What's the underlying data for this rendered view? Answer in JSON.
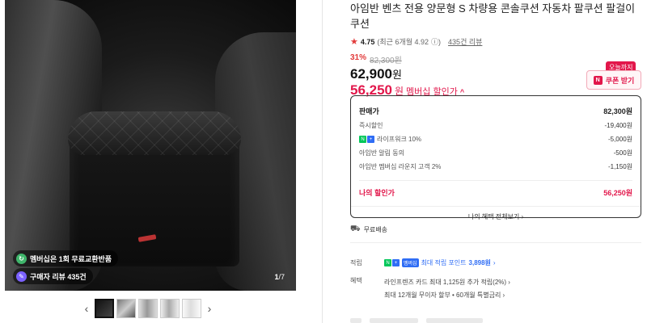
{
  "gallery": {
    "badge_membership": "멤버십은 1회 무료교환반품",
    "badge_reviews": "구매자 리뷰 435건",
    "counter_current": "1",
    "counter_total": "/7"
  },
  "product": {
    "title": "아임반 벤츠 전용 양문형 S 차량용 콘솔쿠션 자동차 팔쿠션 팔걸이쿠션",
    "rating": "4.75",
    "rating_detail": "(최근 6개월 4.92",
    "rating_info": "ⓘ)",
    "review_count": "435건 리뷰",
    "discount_pct": "31%",
    "original_price": "82,300원",
    "sale_price": "62,900",
    "sale_unit": "원",
    "member_price": "56,250",
    "member_unit": "원",
    "member_label": "멤버십 할인가",
    "coupon_label": "쿠폰 받기",
    "today_label": "오늘까지"
  },
  "breakdown": {
    "rows": [
      {
        "label": "판매가",
        "value": "82,300원"
      },
      {
        "label": "즉시할인",
        "value": "-19,400원"
      },
      {
        "label": "라이프워크 10%",
        "value": "-5,000원"
      },
      {
        "label": "아임반 알림 동의",
        "value": "-500원"
      },
      {
        "label": "아임반 멤버십 라운지 고객 2%",
        "value": "-1,150원"
      }
    ],
    "mine_label": "나의 할인가",
    "mine_value": "56,250원",
    "view_all": "나의 혜택 전체보기 ›"
  },
  "shipping": {
    "label": "무료배송"
  },
  "points": {
    "key": "적립",
    "text": "최대 적립 포인트",
    "amount": "3,898원",
    "suffix": "›"
  },
  "benefits": {
    "key": "혜택",
    "line1": "라인프렌즈 카드 최대 1,125원 추가 적립(2%) ›",
    "line2": "최대 12개월 무이자 할부 • 60개월 특별금리 ›"
  },
  "colors": {
    "accent": "#e2174b",
    "naver_green": "#03c75a",
    "blue": "#2f6df5"
  },
  "icons": [
    "star-icon",
    "info-icon",
    "chevron-up-icon",
    "coupon-icon",
    "truck-icon",
    "chevron-left-icon",
    "chevron-right-icon"
  ]
}
